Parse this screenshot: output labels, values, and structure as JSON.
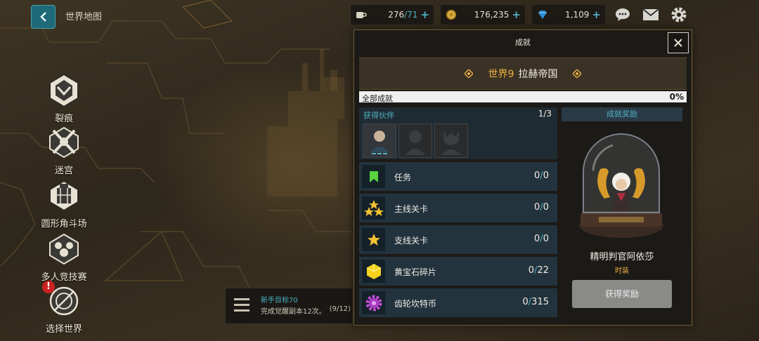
{
  "header": {
    "map_title": "世界地图",
    "resources": [
      {
        "icon": "coffee-icon",
        "value": "276",
        "cap": "71"
      },
      {
        "icon": "gold-coin-icon",
        "value": "176,235"
      },
      {
        "icon": "gem-icon",
        "value": "1,109"
      }
    ],
    "plus_label": "+"
  },
  "left_menu": [
    {
      "icon": "rift-emblem-icon",
      "label": "裂痕"
    },
    {
      "icon": "labyrinth-emblem-icon",
      "label": "迷宫"
    },
    {
      "icon": "colosseum-emblem-icon",
      "label": "圆形角斗场"
    },
    {
      "icon": "arena-emblem-icon",
      "label": "多人竞技赛"
    },
    {
      "icon": "world-select-emblem-icon",
      "label": "选择世界"
    }
  ],
  "alert_badge": "!",
  "notice": {
    "title": "新手目标70",
    "desc": "完成觉醒副本12次。",
    "progress": "(9/12)"
  },
  "panel": {
    "title": "成就",
    "close_label": "✕",
    "world_number": "世界9",
    "world_name": "拉赫帝国",
    "all_label": "全部成就",
    "all_percent": "0%",
    "partners_label": "获得伙伴",
    "partners_count": "1/3",
    "rows": [
      {
        "icon": "bookmark-icon",
        "name": "任务",
        "done": "0",
        "total": "0"
      },
      {
        "icon": "triple-star-icon",
        "name": "主线关卡",
        "done": "0",
        "total": "0"
      },
      {
        "icon": "star-icon",
        "name": "支线关卡",
        "done": "0",
        "total": "0"
      },
      {
        "icon": "topaz-shard-icon",
        "name": "黄宝石碎片",
        "done": "0",
        "total": "22"
      },
      {
        "icon": "gear-coin-icon",
        "name": "齿轮坎特币",
        "done": "0",
        "total": "315"
      }
    ],
    "slash": "/",
    "reward_header": "成就奖励",
    "reward_name": "精明判官阿依莎",
    "reward_type": "时装",
    "claim_label": "获得奖励"
  },
  "colors": {
    "accent_cyan": "#4fb1c4",
    "gold": "#f0b245",
    "panel_bg": "#1c1a17",
    "row_bg": "#23333e"
  }
}
